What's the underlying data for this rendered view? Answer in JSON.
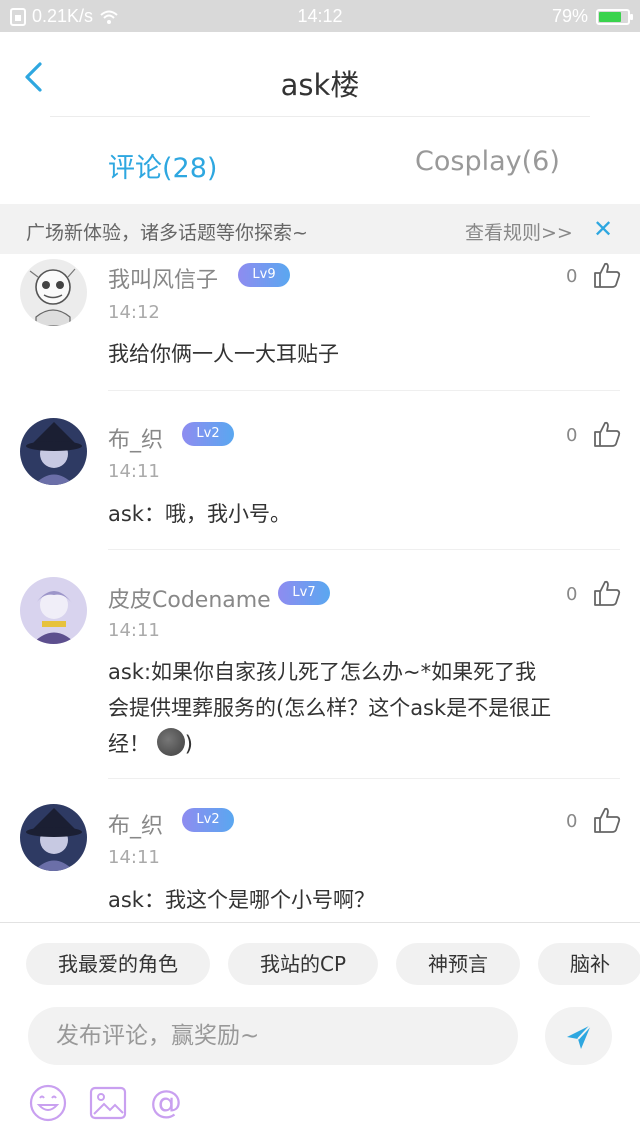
{
  "status_bar": {
    "network_speed": "0.21K/s",
    "time": "14:12",
    "battery": "79%",
    "battery_level": 0.79
  },
  "header": {
    "title": "ask楼",
    "back_icon": "chevron-left-icon"
  },
  "tabs": [
    {
      "label": "评论(28)",
      "active": true
    },
    {
      "label": "Cosplay(6)",
      "active": false
    }
  ],
  "notice": {
    "text": "广场新体验，诸多话题等你探索~",
    "link": "查看规则>>",
    "close": "✕"
  },
  "comments": [
    {
      "user": "我叫风信子",
      "level": "Lv9",
      "time": "14:12",
      "text": "我给你俩一人一大耳贴子",
      "likes": "0"
    },
    {
      "user": "布_织",
      "level": "Lv2",
      "time": "14:11",
      "text": "ask：哦，我小号。",
      "likes": "0"
    },
    {
      "user": "皮皮Codename",
      "level": "Lv7",
      "time": "14:11",
      "text_lines": [
        "ask:如果你自家孩儿死了怎么办~*如果死了我",
        "会提供埋葬服务的(怎么样？这个ask是不是很正",
        "经！"
      ],
      "text_tail": ")",
      "likes": "0"
    },
    {
      "user": "布_织",
      "level": "Lv2",
      "time": "14:11",
      "text": "ask：我这个是哪个小号啊？",
      "likes": "0"
    }
  ],
  "composer": {
    "chips": [
      "我最爱的角色",
      "我站的CP",
      "神预言",
      "脑补"
    ],
    "placeholder": "发布评论，赢奖励~",
    "send_icon": "send-icon",
    "tools": [
      "emoji-icon",
      "image-icon",
      "mention-icon"
    ]
  },
  "colors": {
    "accent": "#2ea7e0",
    "level_badge_start": "#8e8cf0",
    "level_badge_end": "#5aa7f0",
    "tool_icon": "#c9a0f0"
  }
}
